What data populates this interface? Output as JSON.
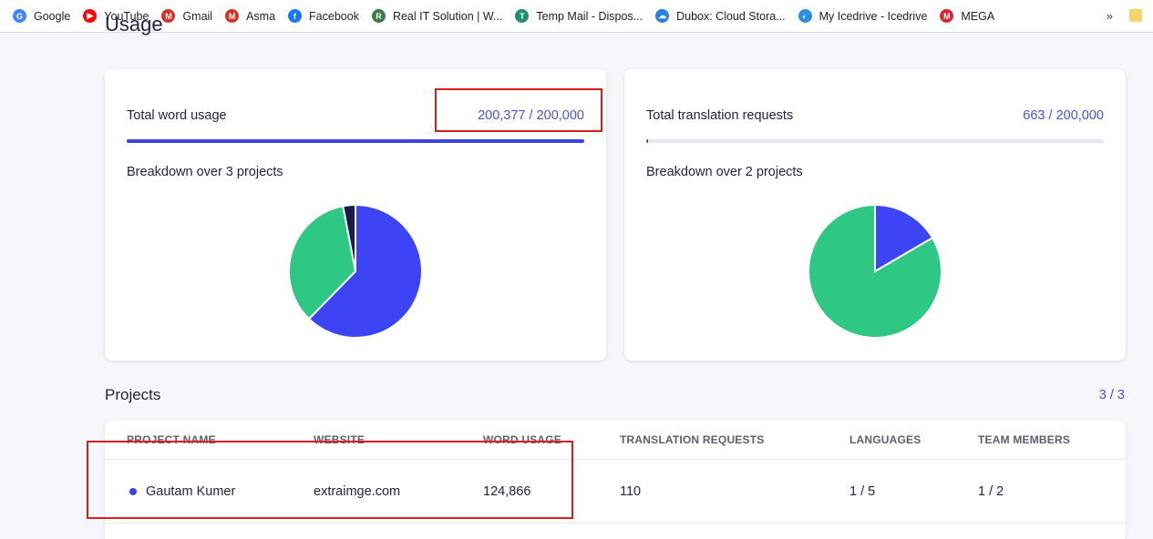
{
  "bookmarks": [
    {
      "label": "Google",
      "icon": "google-icon",
      "color": "#4285f4"
    },
    {
      "label": "YouTube",
      "icon": "youtube-icon",
      "color": "#ff0000"
    },
    {
      "label": "Gmail",
      "icon": "gmail-icon",
      "color": "#d93025"
    },
    {
      "label": "Asma",
      "icon": "gmail-icon",
      "color": "#d93025"
    },
    {
      "label": "Facebook",
      "icon": "facebook-icon",
      "color": "#1877f2"
    },
    {
      "label": "Real IT Solution | W...",
      "icon": "realit-icon",
      "color": "#3a7d44"
    },
    {
      "label": "Temp Mail - Dispos...",
      "icon": "tempmail-icon",
      "color": "#1d8f6e"
    },
    {
      "label": "Dubox: Cloud Stora...",
      "icon": "dubox-icon",
      "color": "#2a7de1"
    },
    {
      "label": "My Icedrive - Icedrive",
      "icon": "icedrive-icon",
      "color": "#2b8de0"
    },
    {
      "label": "MEGA",
      "icon": "mega-icon",
      "color": "#d9272e"
    }
  ],
  "bookmarks_more": "»",
  "page_heading": "Usage",
  "word_card": {
    "label": "Total word usage",
    "value": "200,377 / 200,000",
    "progress": 1.0,
    "breakdown": "Breakdown over 3 projects"
  },
  "translation_card": {
    "label": "Total translation requests",
    "value": "663 / 200,000",
    "progress": 0.0033,
    "breakdown": "Breakdown over 2 projects"
  },
  "chart_data": [
    {
      "type": "pie",
      "values": [
        62.3,
        34.7,
        3.0
      ],
      "colors": [
        "#3d44f5",
        "#2ec784",
        "#1a1a4e"
      ],
      "title": ""
    },
    {
      "type": "pie",
      "values": [
        16.6,
        83.4
      ],
      "colors": [
        "#3d44f5",
        "#2ec784"
      ],
      "title": ""
    }
  ],
  "projects": {
    "title": "Projects",
    "count": "3 / 3",
    "columns": [
      "PROJECT NAME",
      "WEBSITE",
      "WORD USAGE",
      "TRANSLATION REQUESTS",
      "LANGUAGES",
      "TEAM MEMBERS"
    ],
    "rows": [
      {
        "name": "Gautam Kumer",
        "website": "extraimge.com",
        "word_usage": "124,866",
        "translation_requests": "110",
        "languages": "1 / 5",
        "team_members": "1 / 2",
        "dot_color": "#3d44e0"
      }
    ]
  },
  "colors": {
    "accent": "#4a4fd8",
    "highlight": "#e01b1b"
  }
}
